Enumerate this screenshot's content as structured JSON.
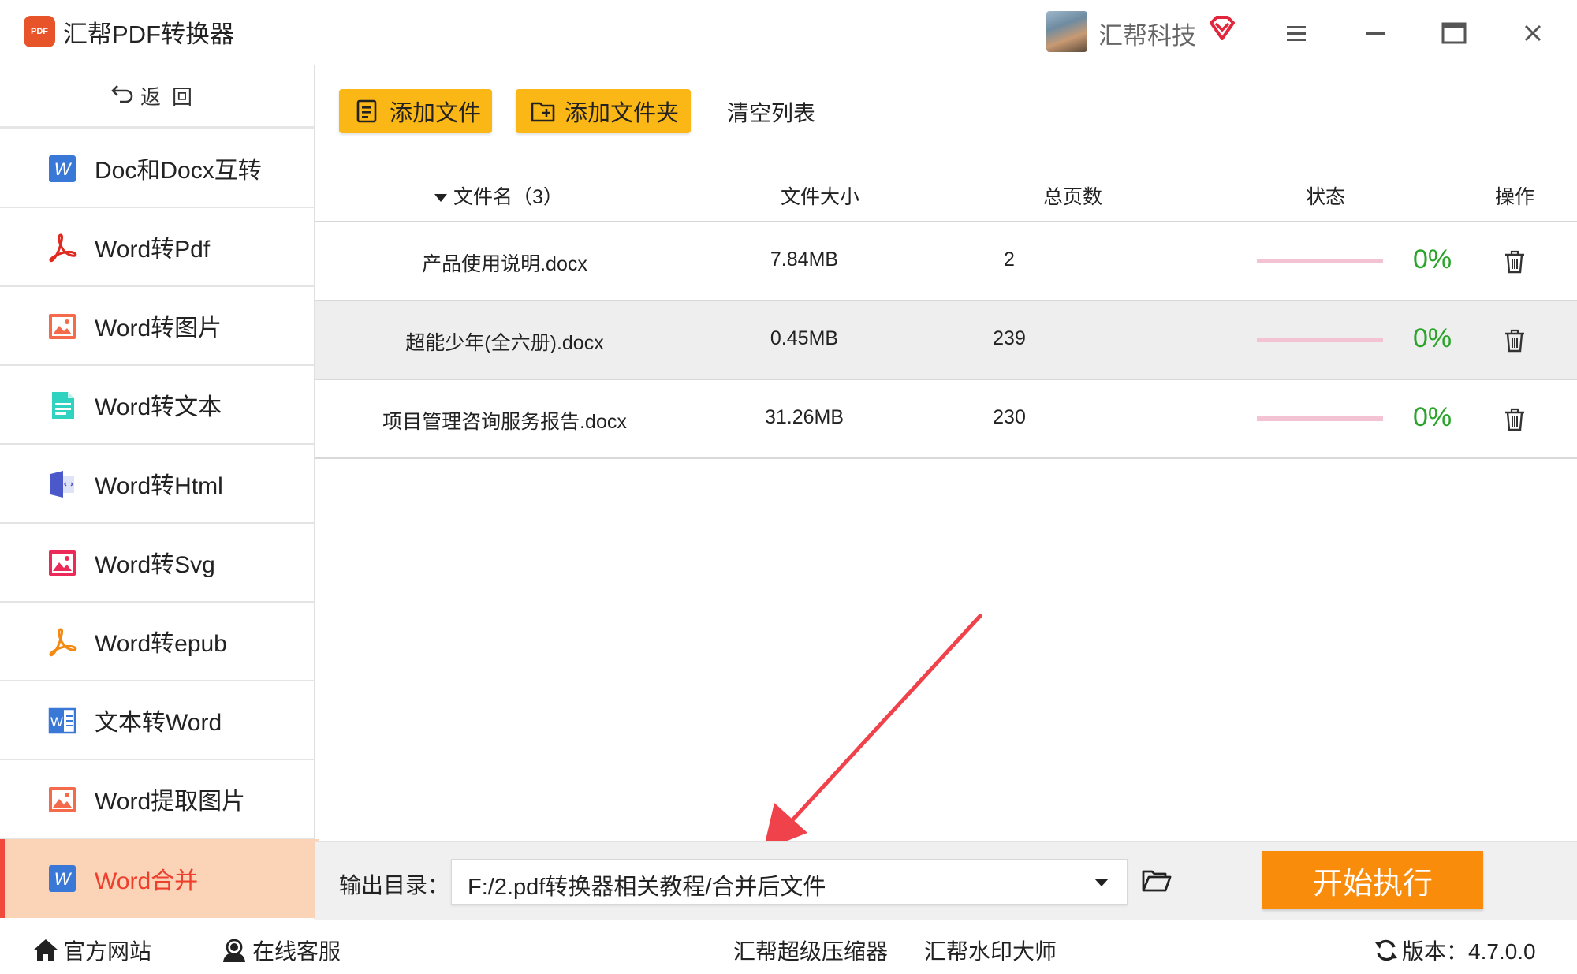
{
  "app": {
    "logo_text": "PDF",
    "title": "汇帮PDF转换器",
    "user_name": "汇帮科技",
    "accent": "#fbb715",
    "active_color": "#ee3e2c"
  },
  "window_controls": [
    "menu-icon",
    "minimize-icon",
    "maximize-icon",
    "close-icon"
  ],
  "sidebar": {
    "back_label": "返回",
    "items": [
      {
        "label": "Doc和Docx互转",
        "icon": "word-doc-icon"
      },
      {
        "label": "Word转Pdf",
        "icon": "pdf-acrobat-icon"
      },
      {
        "label": "Word转图片",
        "icon": "image-icon"
      },
      {
        "label": "Word转文本",
        "icon": "text-file-icon"
      },
      {
        "label": "Word转Html",
        "icon": "html-file-icon"
      },
      {
        "label": "Word转Svg",
        "icon": "svg-image-icon"
      },
      {
        "label": "Word转epub",
        "icon": "epub-acrobat-icon"
      },
      {
        "label": "文本转Word",
        "icon": "word-outline-icon"
      },
      {
        "label": "Word提取图片",
        "icon": "image-icon"
      },
      {
        "label": "Word合并",
        "icon": "word-doc-icon",
        "active": true
      }
    ]
  },
  "toolbar": {
    "add_file": "添加文件",
    "add_folder": "添加文件夹",
    "clear_list": "清空列表"
  },
  "table": {
    "headers": {
      "name": "文件名（3）",
      "size": "文件大小",
      "pages": "总页数",
      "status": "状态",
      "action": "操作"
    },
    "rows": [
      {
        "name": "产品使用说明.docx",
        "size": "7.84MB",
        "pages": "2",
        "progress": "0%"
      },
      {
        "name": "超能少年(全六册).docx",
        "size": "0.45MB",
        "pages": "239",
        "progress": "0%"
      },
      {
        "name": "项目管理咨询服务报告.docx",
        "size": "31.26MB",
        "pages": "230",
        "progress": "0%"
      }
    ]
  },
  "output": {
    "label": "输出目录：",
    "path": "F:/2.pdf转换器相关教程/合并后文件",
    "start_label": "开始执行"
  },
  "footer": {
    "website": "官方网站",
    "support": "在线客服",
    "compressor": "汇帮超级压缩器",
    "watermark": "汇帮水印大师",
    "version": "版本：4.7.0.0"
  },
  "annotation": {
    "color": "#f0424a"
  }
}
